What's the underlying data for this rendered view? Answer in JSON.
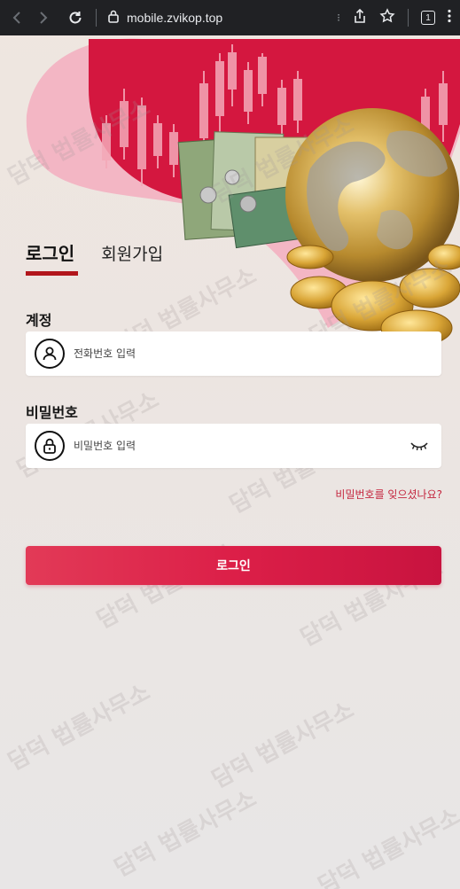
{
  "browser": {
    "url": "mobile.zvikop.top",
    "tab_count": "1"
  },
  "auth_tabs": {
    "login": "로그인",
    "signup": "회원가입"
  },
  "account": {
    "label": "계정",
    "placeholder": "전화번호 입력"
  },
  "password": {
    "label": "비밀번호",
    "placeholder": "비밀번호 입력"
  },
  "forgot_password": "비밀번호를 잊으셨나요?",
  "login_button": "로그인",
  "watermark": {
    "text": "담덕 법률사무소",
    "seal": "사무"
  },
  "colors": {
    "accent": "#dc1f48",
    "tab_underline": "#b2161c",
    "hero_red": "#d4173f",
    "forgot_link": "#c4263e"
  },
  "icons": {
    "back": "back-arrow-icon",
    "forward": "forward-arrow-icon",
    "reload": "reload-icon",
    "site_info": "site-info-icon",
    "share": "share-icon",
    "bookmark": "bookmark-star-icon",
    "menu": "kebab-menu-icon",
    "user": "user-icon",
    "lock": "lock-icon",
    "eye": "eye-closed-icon"
  }
}
